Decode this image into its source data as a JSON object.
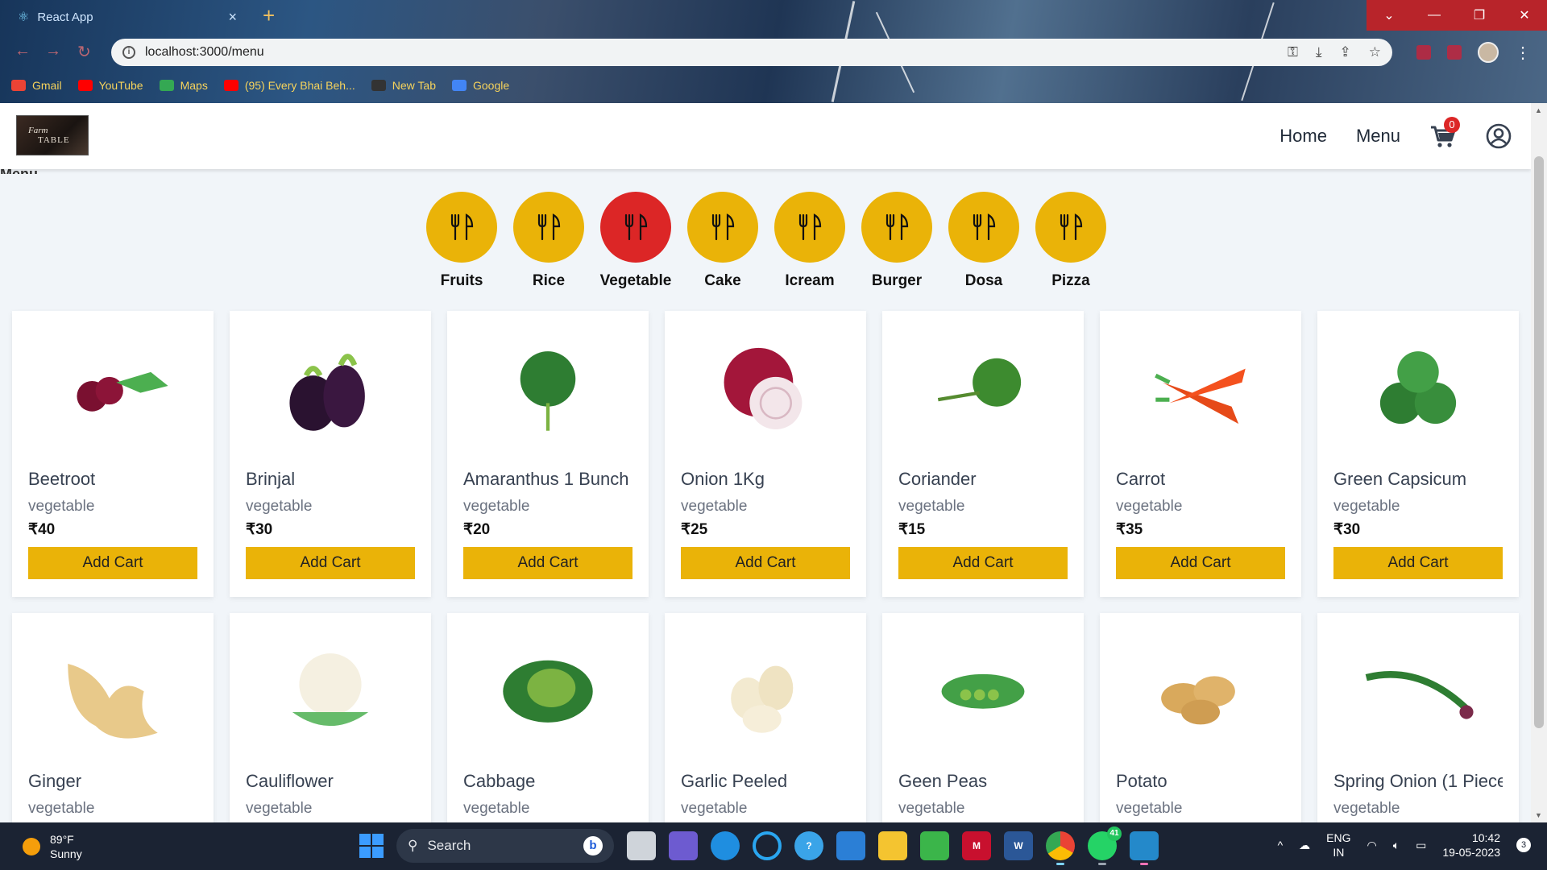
{
  "browser": {
    "tab_title": "React App",
    "url": "localhost:3000/menu",
    "bookmarks": [
      {
        "label": "Gmail",
        "color": "#ea4335"
      },
      {
        "label": "YouTube",
        "color": "#ff0000"
      },
      {
        "label": "Maps",
        "color": "#34a853"
      },
      {
        "label": "(95) Every Bhai Beh...",
        "color": "#ff0000"
      },
      {
        "label": "New Tab",
        "color": "#333333"
      },
      {
        "label": "Google",
        "color": "#4285f4"
      }
    ]
  },
  "header": {
    "logo_line1": "Farm",
    "logo_line2": "TABLE",
    "nav": {
      "home": "Home",
      "menu": "Menu"
    },
    "cart_count": "0"
  },
  "page_heading_stub": "Menu",
  "categories": [
    {
      "label": "Fruits",
      "active": false
    },
    {
      "label": "Rice",
      "active": false
    },
    {
      "label": "Vegetable",
      "active": true
    },
    {
      "label": "Cake",
      "active": false
    },
    {
      "label": "Icream",
      "active": false
    },
    {
      "label": "Burger",
      "active": false
    },
    {
      "label": "Dosa",
      "active": false
    },
    {
      "label": "Pizza",
      "active": false
    }
  ],
  "products": [
    {
      "name": "Beetroot",
      "category": "vegetable",
      "price": "₹40",
      "button": "Add Cart",
      "icon": "beetroot-image"
    },
    {
      "name": "Brinjal",
      "category": "vegetable",
      "price": "₹30",
      "button": "Add Cart",
      "icon": "brinjal-image"
    },
    {
      "name": "Amaranthus 1 Bunch",
      "category": "vegetable",
      "price": "₹20",
      "button": "Add Cart",
      "icon": "amaranthus-image"
    },
    {
      "name": "Onion 1Kg",
      "category": "vegetable",
      "price": "₹25",
      "button": "Add Cart",
      "icon": "onion-image"
    },
    {
      "name": "Coriander",
      "category": "vegetable",
      "price": "₹15",
      "button": "Add Cart",
      "icon": "coriander-image"
    },
    {
      "name": "Carrot",
      "category": "vegetable",
      "price": "₹35",
      "button": "Add Cart",
      "icon": "carrot-image"
    },
    {
      "name": "Green Capsicum",
      "category": "vegetable",
      "price": "₹30",
      "button": "Add Cart",
      "icon": "capsicum-image"
    },
    {
      "name": "Ginger",
      "category": "vegetable",
      "price": "",
      "button": "",
      "icon": "ginger-image"
    },
    {
      "name": "Cauliflower",
      "category": "vegetable",
      "price": "",
      "button": "",
      "icon": "cauliflower-image"
    },
    {
      "name": "Cabbage",
      "category": "vegetable",
      "price": "",
      "button": "",
      "icon": "cabbage-image"
    },
    {
      "name": "Garlic Peeled",
      "category": "vegetable",
      "price": "",
      "button": "",
      "icon": "garlic-image"
    },
    {
      "name": "Geen Peas",
      "category": "vegetable",
      "price": "",
      "button": "",
      "icon": "peas-image"
    },
    {
      "name": "Potato",
      "category": "vegetable",
      "price": "",
      "button": "",
      "icon": "potato-image"
    },
    {
      "name": "Spring Onion (1 Piece",
      "category": "vegetable",
      "price": "",
      "button": "",
      "icon": "spring-onion-image"
    }
  ],
  "taskbar": {
    "weather_temp": "89°F",
    "weather_desc": "Sunny",
    "search_placeholder": "Search",
    "lang_line1": "ENG",
    "lang_line2": "IN",
    "time": "10:42",
    "date": "19-05-2023",
    "notification_count": "3",
    "whatsapp_badge": "41"
  },
  "colors": {
    "accent_yellow": "#eab308",
    "active_red": "#dc2626"
  }
}
